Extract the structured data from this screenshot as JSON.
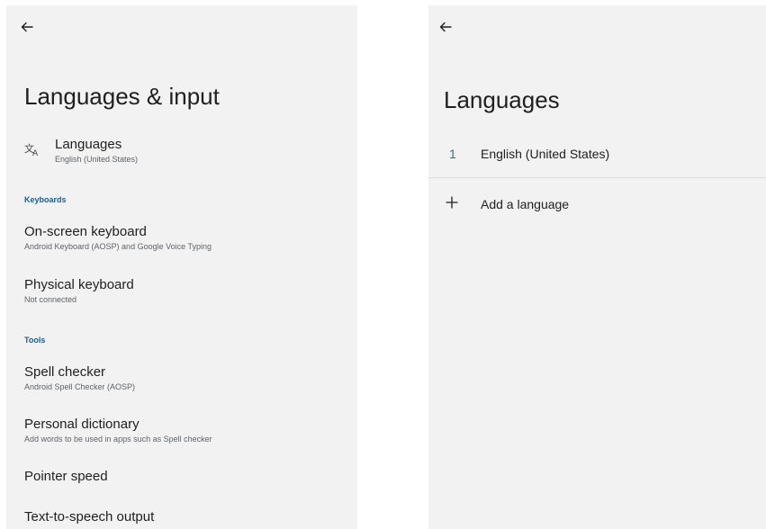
{
  "left": {
    "back_icon": "arrow-back-icon",
    "title": "Languages & input",
    "languages": {
      "icon": "translate-icon",
      "title": "Languages",
      "subtitle": "English (United States)"
    },
    "sections": {
      "keyboards": "Keyboards",
      "tools": "Tools"
    },
    "items": {
      "on_screen_keyboard": {
        "title": "On-screen keyboard",
        "subtitle": "Android Keyboard (AOSP) and Google Voice Typing"
      },
      "physical_keyboard": {
        "title": "Physical keyboard",
        "subtitle": "Not connected"
      },
      "spell_checker": {
        "title": "Spell checker",
        "subtitle": "Android Spell Checker (AOSP)"
      },
      "personal_dictionary": {
        "title": "Personal dictionary",
        "subtitle": "Add words to be used in apps such as Spell checker"
      },
      "pointer_speed": {
        "title": "Pointer speed"
      },
      "tts_output": {
        "title": "Text-to-speech output"
      }
    }
  },
  "right": {
    "back_icon": "arrow-back-icon",
    "title": "Languages",
    "languages_list": [
      {
        "number": "1",
        "name": "English (United States)"
      }
    ],
    "add_language": {
      "icon": "plus-icon",
      "label": "Add a language"
    }
  },
  "colors": {
    "background": "#f2f2f2",
    "accent": "#1a5f8a",
    "text_primary": "#1f1f1f",
    "text_secondary": "#5f6368"
  }
}
